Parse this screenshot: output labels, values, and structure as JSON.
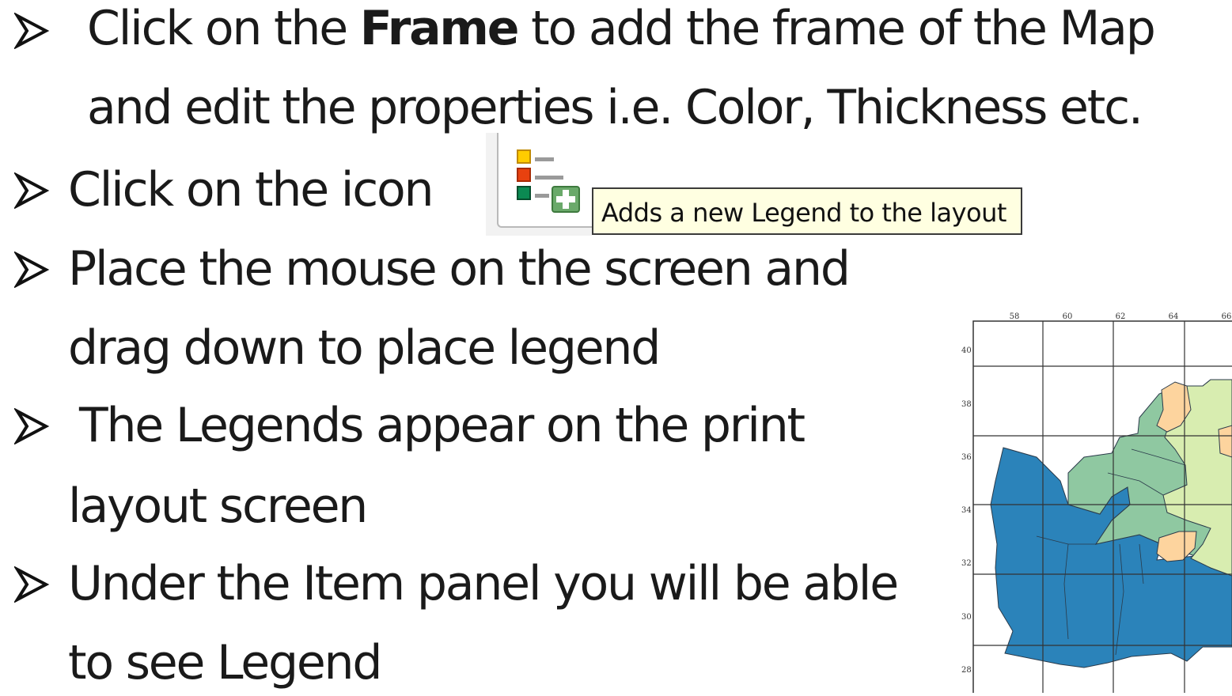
{
  "lines": {
    "l1_pre": "Click on the ",
    "l1_bold": "Frame",
    "l1_post": " to add the frame of the Map",
    "l2": "and edit the properties i.e. Color, Thickness etc.",
    "l3": "Click on the icon",
    "l4": "Place the mouse on the screen and",
    "l5": "drag down to place legend",
    "l6": "The Legends appear on the print",
    "l7": "layout screen",
    "l8": "Under the Item panel you will be able",
    "l9": "to see Legend"
  },
  "tooltip": {
    "text": "Adds a new Legend to the layout"
  },
  "icons": {
    "bullet": "arrow-bullet-icon",
    "legend": "add-legend-icon"
  },
  "map": {
    "x_ticks": [
      "58",
      "60",
      "62",
      "64",
      "66"
    ],
    "y_ticks": [
      "40",
      "38",
      "36",
      "34",
      "32",
      "30",
      "28"
    ],
    "colors": {
      "dark_blue": "#2b83ba",
      "teal_green": "#8fc8a1",
      "light_green": "#d8edb0",
      "tan": "#fdd49e",
      "grid": "#333333"
    }
  }
}
